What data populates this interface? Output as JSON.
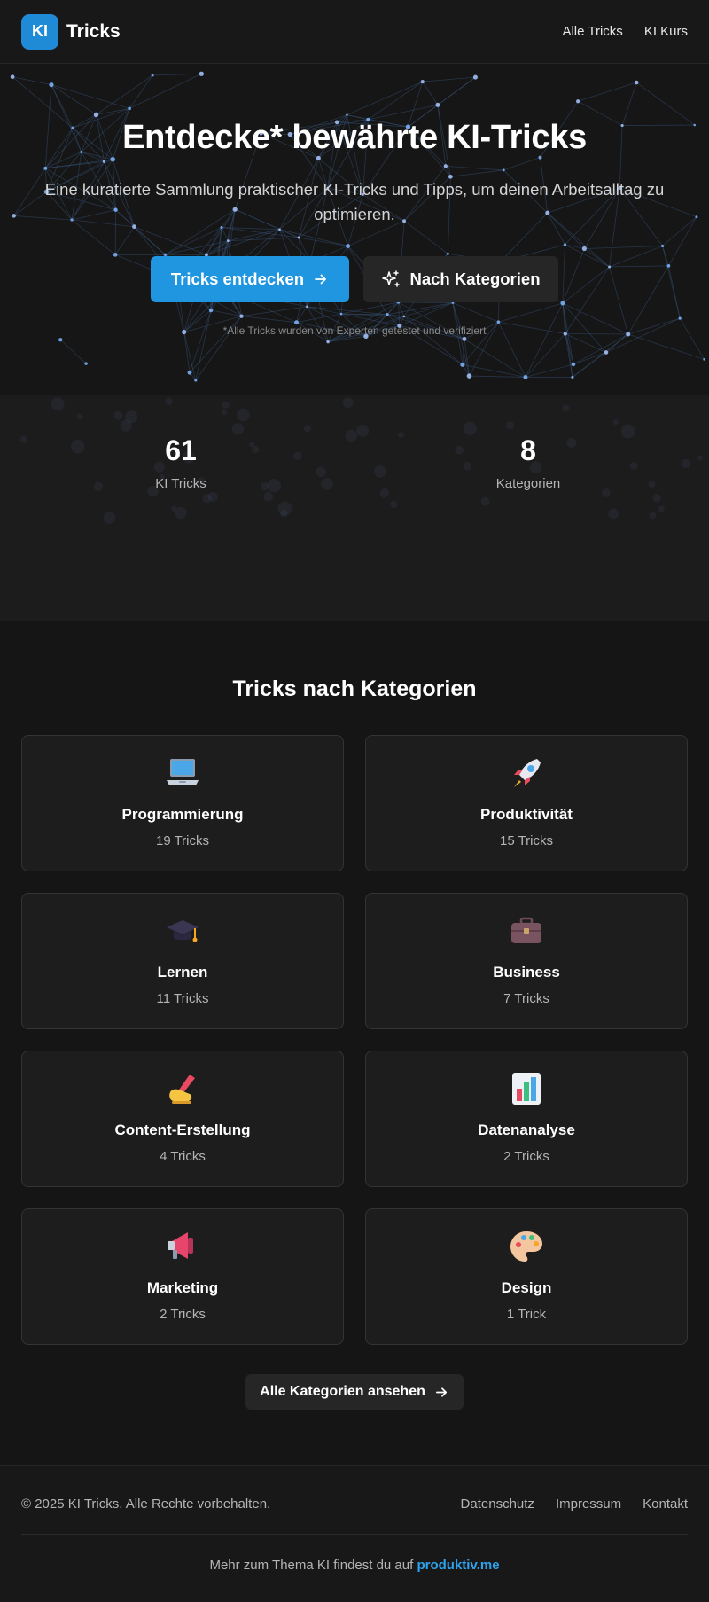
{
  "header": {
    "logo_text": "KI",
    "brand": "Tricks",
    "nav": [
      "Alle Tricks",
      "KI Kurs"
    ]
  },
  "hero": {
    "title": "Entdecke* bewährte KI-Tricks",
    "subtitle": "Eine kuratierte Sammlung praktischer KI-Tricks und Tipps, um deinen Arbeitsalltag zu optimieren.",
    "primary_button": "Tricks entdecken",
    "secondary_button": "Nach Kategorien",
    "note": "*Alle Tricks wurden von Experten getestet und verifiziert"
  },
  "stats": [
    {
      "value": "61",
      "label": "KI Tricks"
    },
    {
      "value": "8",
      "label": "Kategorien"
    }
  ],
  "categories": {
    "title": "Tricks nach Kategorien",
    "items": [
      {
        "name": "Programmierung",
        "count": "19 Tricks",
        "icon": "laptop-icon"
      },
      {
        "name": "Produktivität",
        "count": "15 Tricks",
        "icon": "rocket-icon"
      },
      {
        "name": "Lernen",
        "count": "11 Tricks",
        "icon": "graduation-cap-icon"
      },
      {
        "name": "Business",
        "count": "7 Tricks",
        "icon": "briefcase-icon"
      },
      {
        "name": "Content-Erstellung",
        "count": "4 Tricks",
        "icon": "writing-hand-icon"
      },
      {
        "name": "Datenanalyse",
        "count": "2 Tricks",
        "icon": "bar-chart-icon"
      },
      {
        "name": "Marketing",
        "count": "2 Tricks",
        "icon": "megaphone-icon"
      },
      {
        "name": "Design",
        "count": "1 Trick",
        "icon": "palette-icon"
      }
    ],
    "all_button": "Alle Kategorien ansehen"
  },
  "footer": {
    "copyright": "© 2025 KI Tricks. Alle Rechte vorbehalten.",
    "links": [
      "Datenschutz",
      "Impressum",
      "Kontakt"
    ],
    "more_text": "Mehr zum Thema KI findest du auf",
    "more_link": "produktiv.me"
  },
  "colors": {
    "accent": "#2196e0",
    "background": "#151515",
    "card": "#1d1d1d"
  }
}
